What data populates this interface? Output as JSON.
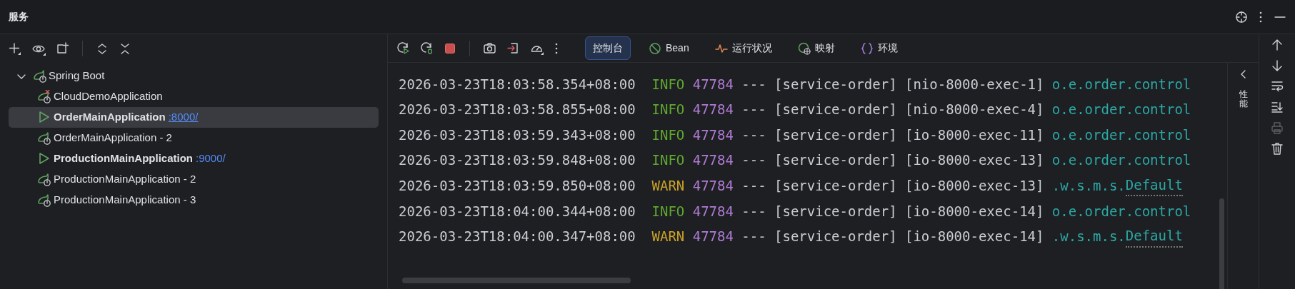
{
  "window": {
    "title": "服务"
  },
  "tree": {
    "root": {
      "label": "Spring Boot",
      "expanded": true,
      "children": [
        {
          "label": "CloudDemoApplication",
          "kind": "stopped",
          "failed": true,
          "selected": false
        },
        {
          "label": "OrderMainApplication",
          "kind": "running",
          "port": ":8000/",
          "failed": false,
          "selected": true
        },
        {
          "label": "OrderMainApplication - 2",
          "kind": "stopped",
          "failed": false,
          "selected": false
        },
        {
          "label": "ProductionMainApplication",
          "kind": "running",
          "port": ":9000/",
          "failed": false,
          "selected": false
        },
        {
          "label": "ProductionMainApplication - 2",
          "kind": "stopped",
          "failed": false,
          "selected": false
        },
        {
          "label": "ProductionMainApplication - 3",
          "kind": "stopped",
          "failed": false,
          "selected": false
        }
      ]
    }
  },
  "tabs": [
    {
      "label": "控制台",
      "kind": "console",
      "selected": true
    },
    {
      "label": "Bean",
      "kind": "bean",
      "selected": false
    },
    {
      "label": "运行状况",
      "kind": "health",
      "selected": false
    },
    {
      "label": "映射",
      "kind": "mapping",
      "selected": false
    },
    {
      "label": "环境",
      "kind": "env",
      "selected": false
    }
  ],
  "log": [
    {
      "time": "2026-03-23T18:03:58.354+08:00",
      "level": "INFO",
      "kind": "info",
      "pid": "47784",
      "sep": "---",
      "app": "[service-order]",
      "thread": "[nio-8000-exec-1]",
      "logger": "o.e.order.control"
    },
    {
      "time": "2026-03-23T18:03:58.855+08:00",
      "level": "INFO",
      "kind": "info",
      "pid": "47784",
      "sep": "---",
      "app": "[service-order]",
      "thread": "[nio-8000-exec-4]",
      "logger": "o.e.order.control"
    },
    {
      "time": "2026-03-23T18:03:59.343+08:00",
      "level": "INFO",
      "kind": "info",
      "pid": "47784",
      "sep": "---",
      "app": "[service-order]",
      "thread": "[io-8000-exec-11]",
      "logger": "o.e.order.control"
    },
    {
      "time": "2026-03-23T18:03:59.848+08:00",
      "level": "INFO",
      "kind": "info",
      "pid": "47784",
      "sep": "---",
      "app": "[service-order]",
      "thread": "[io-8000-exec-13]",
      "logger": "o.e.order.control"
    },
    {
      "time": "2026-03-23T18:03:59.850+08:00",
      "level": "WARN",
      "kind": "warn",
      "pid": "47784",
      "sep": "---",
      "app": "[service-order]",
      "thread": "[io-8000-exec-13]",
      "logger": ".w.s.m.s.",
      "logger_link": "Default"
    },
    {
      "time": "2026-03-23T18:04:00.344+08:00",
      "level": "INFO",
      "kind": "info",
      "pid": "47784",
      "sep": "---",
      "app": "[service-order]",
      "thread": "[io-8000-exec-14]",
      "logger": "o.e.order.control"
    },
    {
      "time": "2026-03-23T18:04:00.347+08:00",
      "level": "WARN",
      "kind": "warn",
      "pid": "47784",
      "sep": "---",
      "app": "[service-order]",
      "thread": "[io-8000-exec-14]",
      "logger": ".w.s.m.s.",
      "logger_link": "Default"
    }
  ],
  "side_panel": {
    "label": "性能"
  }
}
